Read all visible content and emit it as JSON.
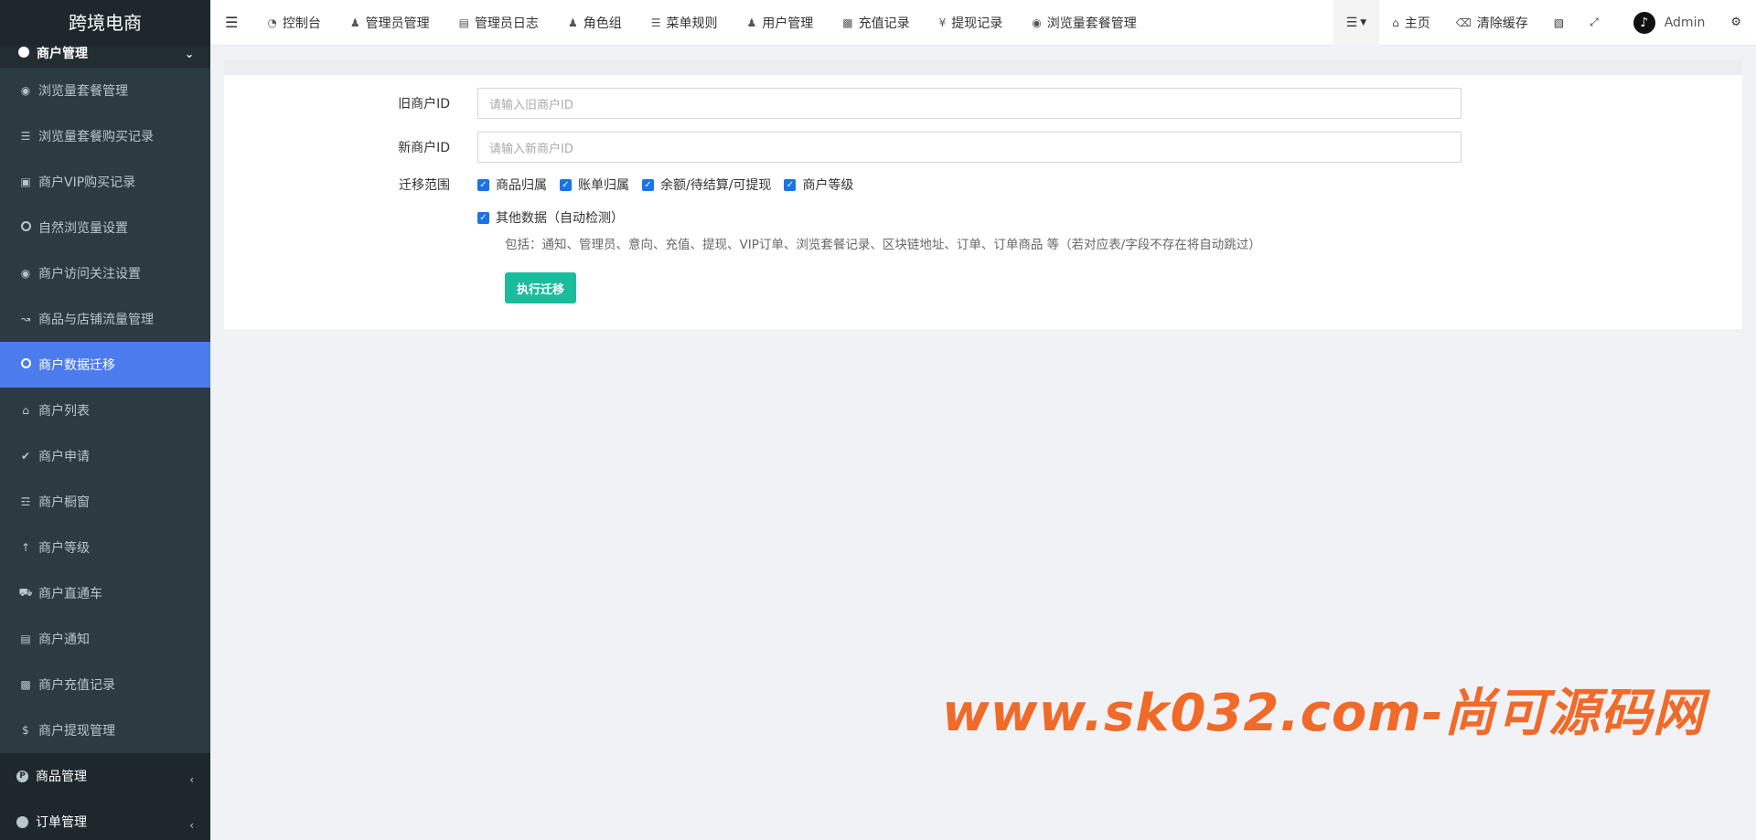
{
  "app": {
    "title": "跨境电商"
  },
  "sidebar": {
    "group_header": "商户管理",
    "items": [
      {
        "label": "浏览量套餐管理",
        "icon": "eye-icon"
      },
      {
        "label": "浏览量套餐购买记录",
        "icon": "list-icon"
      },
      {
        "label": "商户VIP购买记录",
        "icon": "shopping-bag-icon"
      },
      {
        "label": "自然浏览量设置",
        "icon": "circle-icon"
      },
      {
        "label": "商户访问关注设置",
        "icon": "eye-icon"
      },
      {
        "label": "商品与店铺流量管理",
        "icon": "line-chart-icon"
      },
      {
        "label": "商户数据迁移",
        "icon": "circle-icon"
      },
      {
        "label": "商户列表",
        "icon": "home-icon"
      },
      {
        "label": "商户申请",
        "icon": "check-circle-icon"
      },
      {
        "label": "商户橱窗",
        "icon": "cart-icon"
      },
      {
        "label": "商户等级",
        "icon": "level-up-icon"
      },
      {
        "label": "商户直通车",
        "icon": "car-icon"
      },
      {
        "label": "商户通知",
        "icon": "newspaper-icon"
      },
      {
        "label": "商户充值记录",
        "icon": "money-icon"
      },
      {
        "label": "商户提现管理",
        "icon": "dollar-icon"
      }
    ],
    "groups": [
      {
        "label": "商品管理"
      },
      {
        "label": "订单管理"
      }
    ]
  },
  "header": {
    "nav": [
      {
        "label": "控制台",
        "icon": "dashboard-icon"
      },
      {
        "label": "管理员管理",
        "icon": "user-icon"
      },
      {
        "label": "管理员日志",
        "icon": "log-icon"
      },
      {
        "label": "角色组",
        "icon": "group-icon"
      },
      {
        "label": "菜单规则",
        "icon": "bars-icon"
      },
      {
        "label": "用户管理",
        "icon": "user-icon"
      },
      {
        "label": "充值记录",
        "icon": "money-icon"
      },
      {
        "label": "提现记录",
        "icon": "yen-icon"
      },
      {
        "label": "浏览量套餐管理",
        "icon": "eye-icon"
      }
    ],
    "home_label": "主页",
    "clear_cache_label": "清除缓存",
    "user_name": "Admin"
  },
  "form": {
    "old_id_label": "旧商户ID",
    "old_id_placeholder": "请输入旧商户ID",
    "new_id_label": "新商户ID",
    "new_id_placeholder": "请输入新商户ID",
    "scope_label": "迁移范围",
    "scope_options": [
      {
        "label": "商品归属",
        "checked": true
      },
      {
        "label": "账单归属",
        "checked": true
      },
      {
        "label": "余额/待结算/可提现",
        "checked": true
      },
      {
        "label": "商户等级",
        "checked": true
      },
      {
        "label": "其他数据（自动检测）",
        "checked": true
      }
    ],
    "help_text": "包括：通知、管理员、意向、充值、提现、VIP订单、浏览套餐记录、区块链地址、订单、订单商品 等（若对应表/字段不存在将自动跳过）",
    "submit_label": "执行迁移"
  },
  "watermark": "www.sk032.com-尚可源码网",
  "colors": {
    "accent": "#4b7bec",
    "button": "#1abc9c",
    "sidebar_bg": "#222d32",
    "checkbox": "#1a73e8",
    "watermark": "#f06a2a"
  }
}
